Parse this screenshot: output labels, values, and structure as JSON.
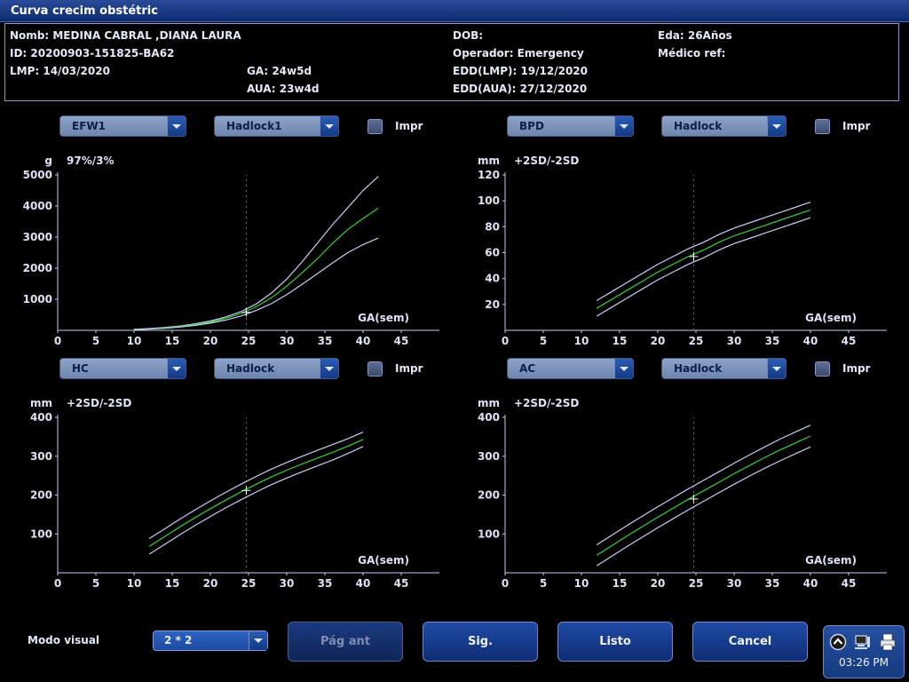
{
  "window": {
    "title": "Curva crecim obstétric"
  },
  "patient": {
    "name": "Nomb: MEDINA CABRAL ,DIANA LAURA",
    "id": "ID: 20200903-151825-BA62",
    "lmp": "LMP: 14/03/2020",
    "ga": "GA: 24w5d",
    "aua": "AUA: 23w4d",
    "dob": "DOB:",
    "operator": "Operador: Emergency",
    "edd_lmp": "EDD(LMP): 19/12/2020",
    "edd_aua": "EDD(AUA): 27/12/2020",
    "age": "Eda: 26Años",
    "ref_doctor": "Médico ref:"
  },
  "panels": [
    {
      "measure": "EFW1",
      "formula": "Hadlock1",
      "impr_label": "Impr",
      "impr_checked": false
    },
    {
      "measure": "BPD",
      "formula": "Hadlock",
      "impr_label": "Impr",
      "impr_checked": false
    },
    {
      "measure": "HC",
      "formula": "Hadlock",
      "impr_label": "Impr",
      "impr_checked": false
    },
    {
      "measure": "AC",
      "formula": "Hadlock",
      "impr_label": "Impr",
      "impr_checked": false
    }
  ],
  "chart_data": [
    {
      "type": "line",
      "unit": "g",
      "band_label": "97%/3%",
      "xlabel": "GA(sem)",
      "xlim": [
        0,
        50
      ],
      "ylim": [
        0,
        5000
      ],
      "xticks": [
        0,
        5,
        10,
        15,
        20,
        25,
        30,
        35,
        40,
        45
      ],
      "yticks": [
        1000,
        2000,
        3000,
        4000,
        5000
      ],
      "current_ga": 24.7,
      "current_value": 580,
      "x": [
        10,
        12,
        14,
        16,
        18,
        20,
        22,
        24,
        26,
        28,
        30,
        32,
        34,
        36,
        38,
        40,
        42
      ],
      "series": [
        {
          "values": [
            35,
            58,
            95,
            140,
            210,
            300,
            430,
            600,
            850,
            1200,
            1650,
            2200,
            2800,
            3400,
            3950,
            4500,
            4950
          ]
        },
        {
          "values": [
            30,
            50,
            85,
            125,
            190,
            270,
            390,
            540,
            760,
            1050,
            1420,
            1850,
            2300,
            2800,
            3250,
            3600,
            3930
          ]
        },
        {
          "values": [
            25,
            42,
            70,
            105,
            160,
            230,
            330,
            460,
            640,
            860,
            1150,
            1480,
            1820,
            2170,
            2500,
            2760,
            2970
          ]
        }
      ]
    },
    {
      "type": "line",
      "unit": "mm",
      "band_label": "+2SD/-2SD",
      "xlabel": "GA(sem)",
      "xlim": [
        0,
        50
      ],
      "ylim": [
        0,
        120
      ],
      "xticks": [
        0,
        5,
        10,
        15,
        20,
        25,
        30,
        35,
        40,
        45
      ],
      "yticks": [
        20,
        40,
        60,
        80,
        100,
        120
      ],
      "current_ga": 24.7,
      "current_value": 57,
      "x": [
        12,
        14,
        16,
        18,
        20,
        22,
        24,
        26,
        28,
        30,
        32,
        34,
        36,
        38,
        40
      ],
      "series": [
        {
          "values": [
            23,
            30,
            37,
            44,
            51,
            57,
            63,
            68,
            74,
            79,
            83,
            87,
            91,
            95,
            99
          ]
        },
        {
          "values": [
            17,
            24,
            31,
            38,
            45,
            51,
            57,
            62,
            68,
            73,
            77,
            81,
            85,
            89,
            93
          ]
        },
        {
          "values": [
            11,
            18,
            25,
            32,
            39,
            45,
            51,
            56,
            62,
            67,
            71,
            75,
            79,
            83,
            87
          ]
        }
      ]
    },
    {
      "type": "line",
      "unit": "mm",
      "band_label": "+2SD/-2SD",
      "xlabel": "GA(sem)",
      "xlim": [
        0,
        50
      ],
      "ylim": [
        0,
        400
      ],
      "xticks": [
        0,
        5,
        10,
        15,
        20,
        25,
        30,
        35,
        40,
        45
      ],
      "yticks": [
        100,
        200,
        300,
        400
      ],
      "current_ga": 24.7,
      "current_value": 212,
      "x": [
        12,
        14,
        16,
        18,
        20,
        22,
        24,
        26,
        28,
        30,
        32,
        34,
        36,
        38,
        40
      ],
      "series": [
        {
          "values": [
            88,
            113,
            138,
            162,
            185,
            207,
            228,
            248,
            267,
            284,
            300,
            315,
            330,
            345,
            362
          ]
        },
        {
          "values": [
            68,
            93,
            118,
            142,
            165,
            187,
            208,
            228,
            247,
            264,
            280,
            295,
            310,
            326,
            343
          ]
        },
        {
          "values": [
            48,
            73,
            98,
            122,
            145,
            167,
            188,
            208,
            227,
            244,
            260,
            275,
            290,
            307,
            325
          ]
        }
      ]
    },
    {
      "type": "line",
      "unit": "mm",
      "band_label": "+2SD/-2SD",
      "xlabel": "GA(sem)",
      "xlim": [
        0,
        50
      ],
      "ylim": [
        0,
        400
      ],
      "xticks": [
        0,
        5,
        10,
        15,
        20,
        25,
        30,
        35,
        40,
        45
      ],
      "yticks": [
        100,
        200,
        300,
        400
      ],
      "current_ga": 24.7,
      "current_value": 190,
      "x": [
        12,
        14,
        16,
        18,
        20,
        22,
        24,
        26,
        28,
        30,
        32,
        34,
        36,
        38,
        40
      ],
      "series": [
        {
          "values": [
            72,
            97,
            122,
            146,
            170,
            193,
            216,
            238,
            260,
            282,
            303,
            324,
            344,
            362,
            380
          ]
        },
        {
          "values": [
            45,
            70,
            95,
            119,
            143,
            166,
            189,
            211,
            233,
            255,
            276,
            297,
            316,
            334,
            352
          ]
        },
        {
          "values": [
            18,
            43,
            68,
            92,
            116,
            139,
            162,
            184,
            206,
            228,
            249,
            269,
            288,
            306,
            324
          ]
        }
      ]
    }
  ],
  "colors": {
    "band": "#c9cdf6",
    "mean": "#35d335",
    "axis": "#c9cdf6",
    "ga_marker": "#1fb51f",
    "point": "#ffffff"
  },
  "footer": {
    "visual_mode_label": "Modo visual",
    "visual_mode_value": "2 * 2",
    "prev_page": "Pág ant",
    "next": "Sig.",
    "done": "Listo",
    "cancel": "Cancel",
    "time": "03:26 PM",
    "tray_icons": [
      "up-arrow-icon",
      "computer-icon",
      "printer-icon"
    ]
  }
}
